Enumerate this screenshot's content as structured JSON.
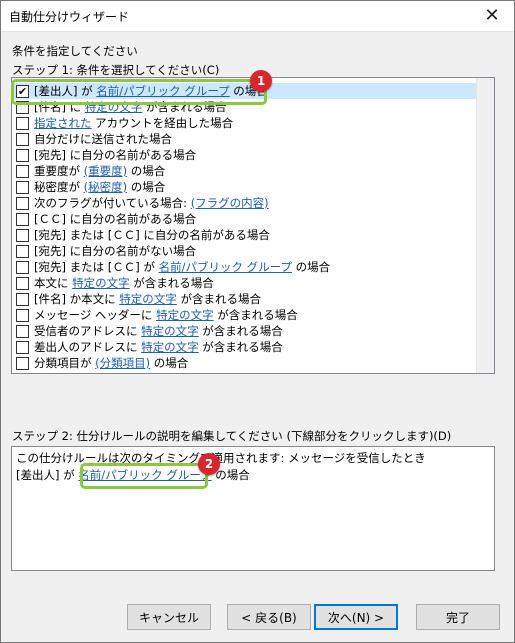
{
  "window": {
    "title": "自動仕分けウィザード",
    "close_glyph": "✕"
  },
  "instruction": "条件を指定してください",
  "step1": {
    "label": "ステップ 1: 条件を選択してください(C)",
    "items": [
      {
        "checked": true,
        "parts": [
          {
            "t": "[差出人] が "
          },
          {
            "t": "名前/パブリック グループ",
            "link": true
          },
          {
            "t": " の場合"
          }
        ]
      },
      {
        "checked": false,
        "parts": [
          {
            "t": "[件名] に "
          },
          {
            "t": "特定の文字",
            "link": true
          },
          {
            "t": " が含まれる場合"
          }
        ]
      },
      {
        "checked": false,
        "parts": [
          {
            "t": "指定された",
            "link": true
          },
          {
            "t": " アカウントを経由した場合"
          }
        ]
      },
      {
        "checked": false,
        "parts": [
          {
            "t": "自分だけに送信された場合"
          }
        ]
      },
      {
        "checked": false,
        "parts": [
          {
            "t": "[宛先] に自分の名前がある場合"
          }
        ]
      },
      {
        "checked": false,
        "parts": [
          {
            "t": "重要度が "
          },
          {
            "t": "(重要度)",
            "link": true
          },
          {
            "t": " の場合"
          }
        ]
      },
      {
        "checked": false,
        "parts": [
          {
            "t": "秘密度が "
          },
          {
            "t": "(秘密度)",
            "link": true
          },
          {
            "t": " の場合"
          }
        ]
      },
      {
        "checked": false,
        "parts": [
          {
            "t": "次のフラグが付いている場合: "
          },
          {
            "t": "(フラグの内容)",
            "link": true
          }
        ]
      },
      {
        "checked": false,
        "parts": [
          {
            "t": "[ＣＣ] に自分の名前がある場合"
          }
        ]
      },
      {
        "checked": false,
        "parts": [
          {
            "t": "[宛先] または [ＣＣ] に自分の名前がある場合"
          }
        ]
      },
      {
        "checked": false,
        "parts": [
          {
            "t": "[宛先] に自分の名前がない場合"
          }
        ]
      },
      {
        "checked": false,
        "parts": [
          {
            "t": "[宛先] または [ＣＣ] が "
          },
          {
            "t": "名前/パブリック グループ",
            "link": true
          },
          {
            "t": " の場合"
          }
        ]
      },
      {
        "checked": false,
        "parts": [
          {
            "t": "本文に "
          },
          {
            "t": "特定の文字",
            "link": true
          },
          {
            "t": " が含まれる場合"
          }
        ]
      },
      {
        "checked": false,
        "parts": [
          {
            "t": "[件名] か本文に "
          },
          {
            "t": "特定の文字",
            "link": true
          },
          {
            "t": " が含まれる場合"
          }
        ]
      },
      {
        "checked": false,
        "parts": [
          {
            "t": "メッセージ ヘッダーに "
          },
          {
            "t": "特定の文字",
            "link": true
          },
          {
            "t": " が含まれる場合"
          }
        ]
      },
      {
        "checked": false,
        "parts": [
          {
            "t": "受信者のアドレスに "
          },
          {
            "t": "特定の文字",
            "link": true
          },
          {
            "t": " が含まれる場合"
          }
        ]
      },
      {
        "checked": false,
        "parts": [
          {
            "t": "差出人のアドレスに "
          },
          {
            "t": "特定の文字",
            "link": true
          },
          {
            "t": " が含まれる場合"
          }
        ]
      },
      {
        "checked": false,
        "parts": [
          {
            "t": "分類項目が "
          },
          {
            "t": "(分類項目)",
            "link": true
          },
          {
            "t": " の場合"
          }
        ]
      }
    ]
  },
  "step2": {
    "label": "ステップ 2: 仕分けルールの説明を編集してください (下線部分をクリックします)(D)",
    "line1": "この仕分けルールは次のタイミングで適用されます: メッセージを受信したとき",
    "line2_prefix": "[差出人] が ",
    "line2_link": "名前/パブリック グループ",
    "line2_suffix": " の場合"
  },
  "buttons": {
    "cancel": "キャンセル",
    "back": "< 戻る(B)",
    "next": "次へ(N) >",
    "finish": "完了"
  },
  "callouts": {
    "one": "1",
    "two": "2"
  },
  "colors": {
    "link": "#1f5fb0",
    "selection": "#cce8ff",
    "callout_badge": "#d9262e",
    "callout_outline": "#8dc63f"
  }
}
